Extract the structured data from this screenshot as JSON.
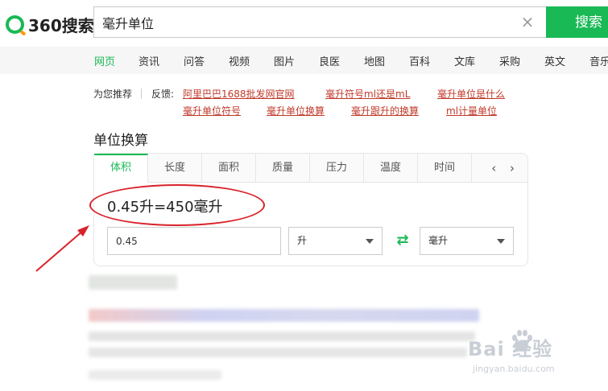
{
  "header": {
    "logo_text": "360搜索",
    "search_value": "毫升单位",
    "clear_icon": "×",
    "search_button": "搜索"
  },
  "nav": {
    "items": [
      "网页",
      "资讯",
      "问答",
      "视频",
      "图片",
      "良医",
      "地图",
      "百科",
      "文库",
      "采购",
      "英文",
      "音乐"
    ],
    "active_index": 0
  },
  "recommend": {
    "label": "为您推荐",
    "feedback": "反馈:",
    "links": [
      "阿里巴巴1688批发网官网",
      "毫升符号ml还是mL",
      "毫升单位是什么",
      "毫升单位符号",
      "毫升单位换算",
      "毫升跟升的换算",
      "ml计量单位"
    ]
  },
  "converter": {
    "title": "单位换算",
    "tabs": [
      "体积",
      "长度",
      "面积",
      "质量",
      "压力",
      "温度",
      "时间"
    ],
    "active_tab": 0,
    "arrows": "‹ ›",
    "result": "0.45升=450毫升",
    "input_value": "0.45",
    "from_unit": "升",
    "to_unit": "毫升",
    "swap_icon": "⇄"
  },
  "watermark": {
    "text": "Bai  经验",
    "url": "jingyan.baidu.com"
  },
  "colors": {
    "brand": "#19b955",
    "link": "#c0392b",
    "annotation": "#d9222a"
  }
}
